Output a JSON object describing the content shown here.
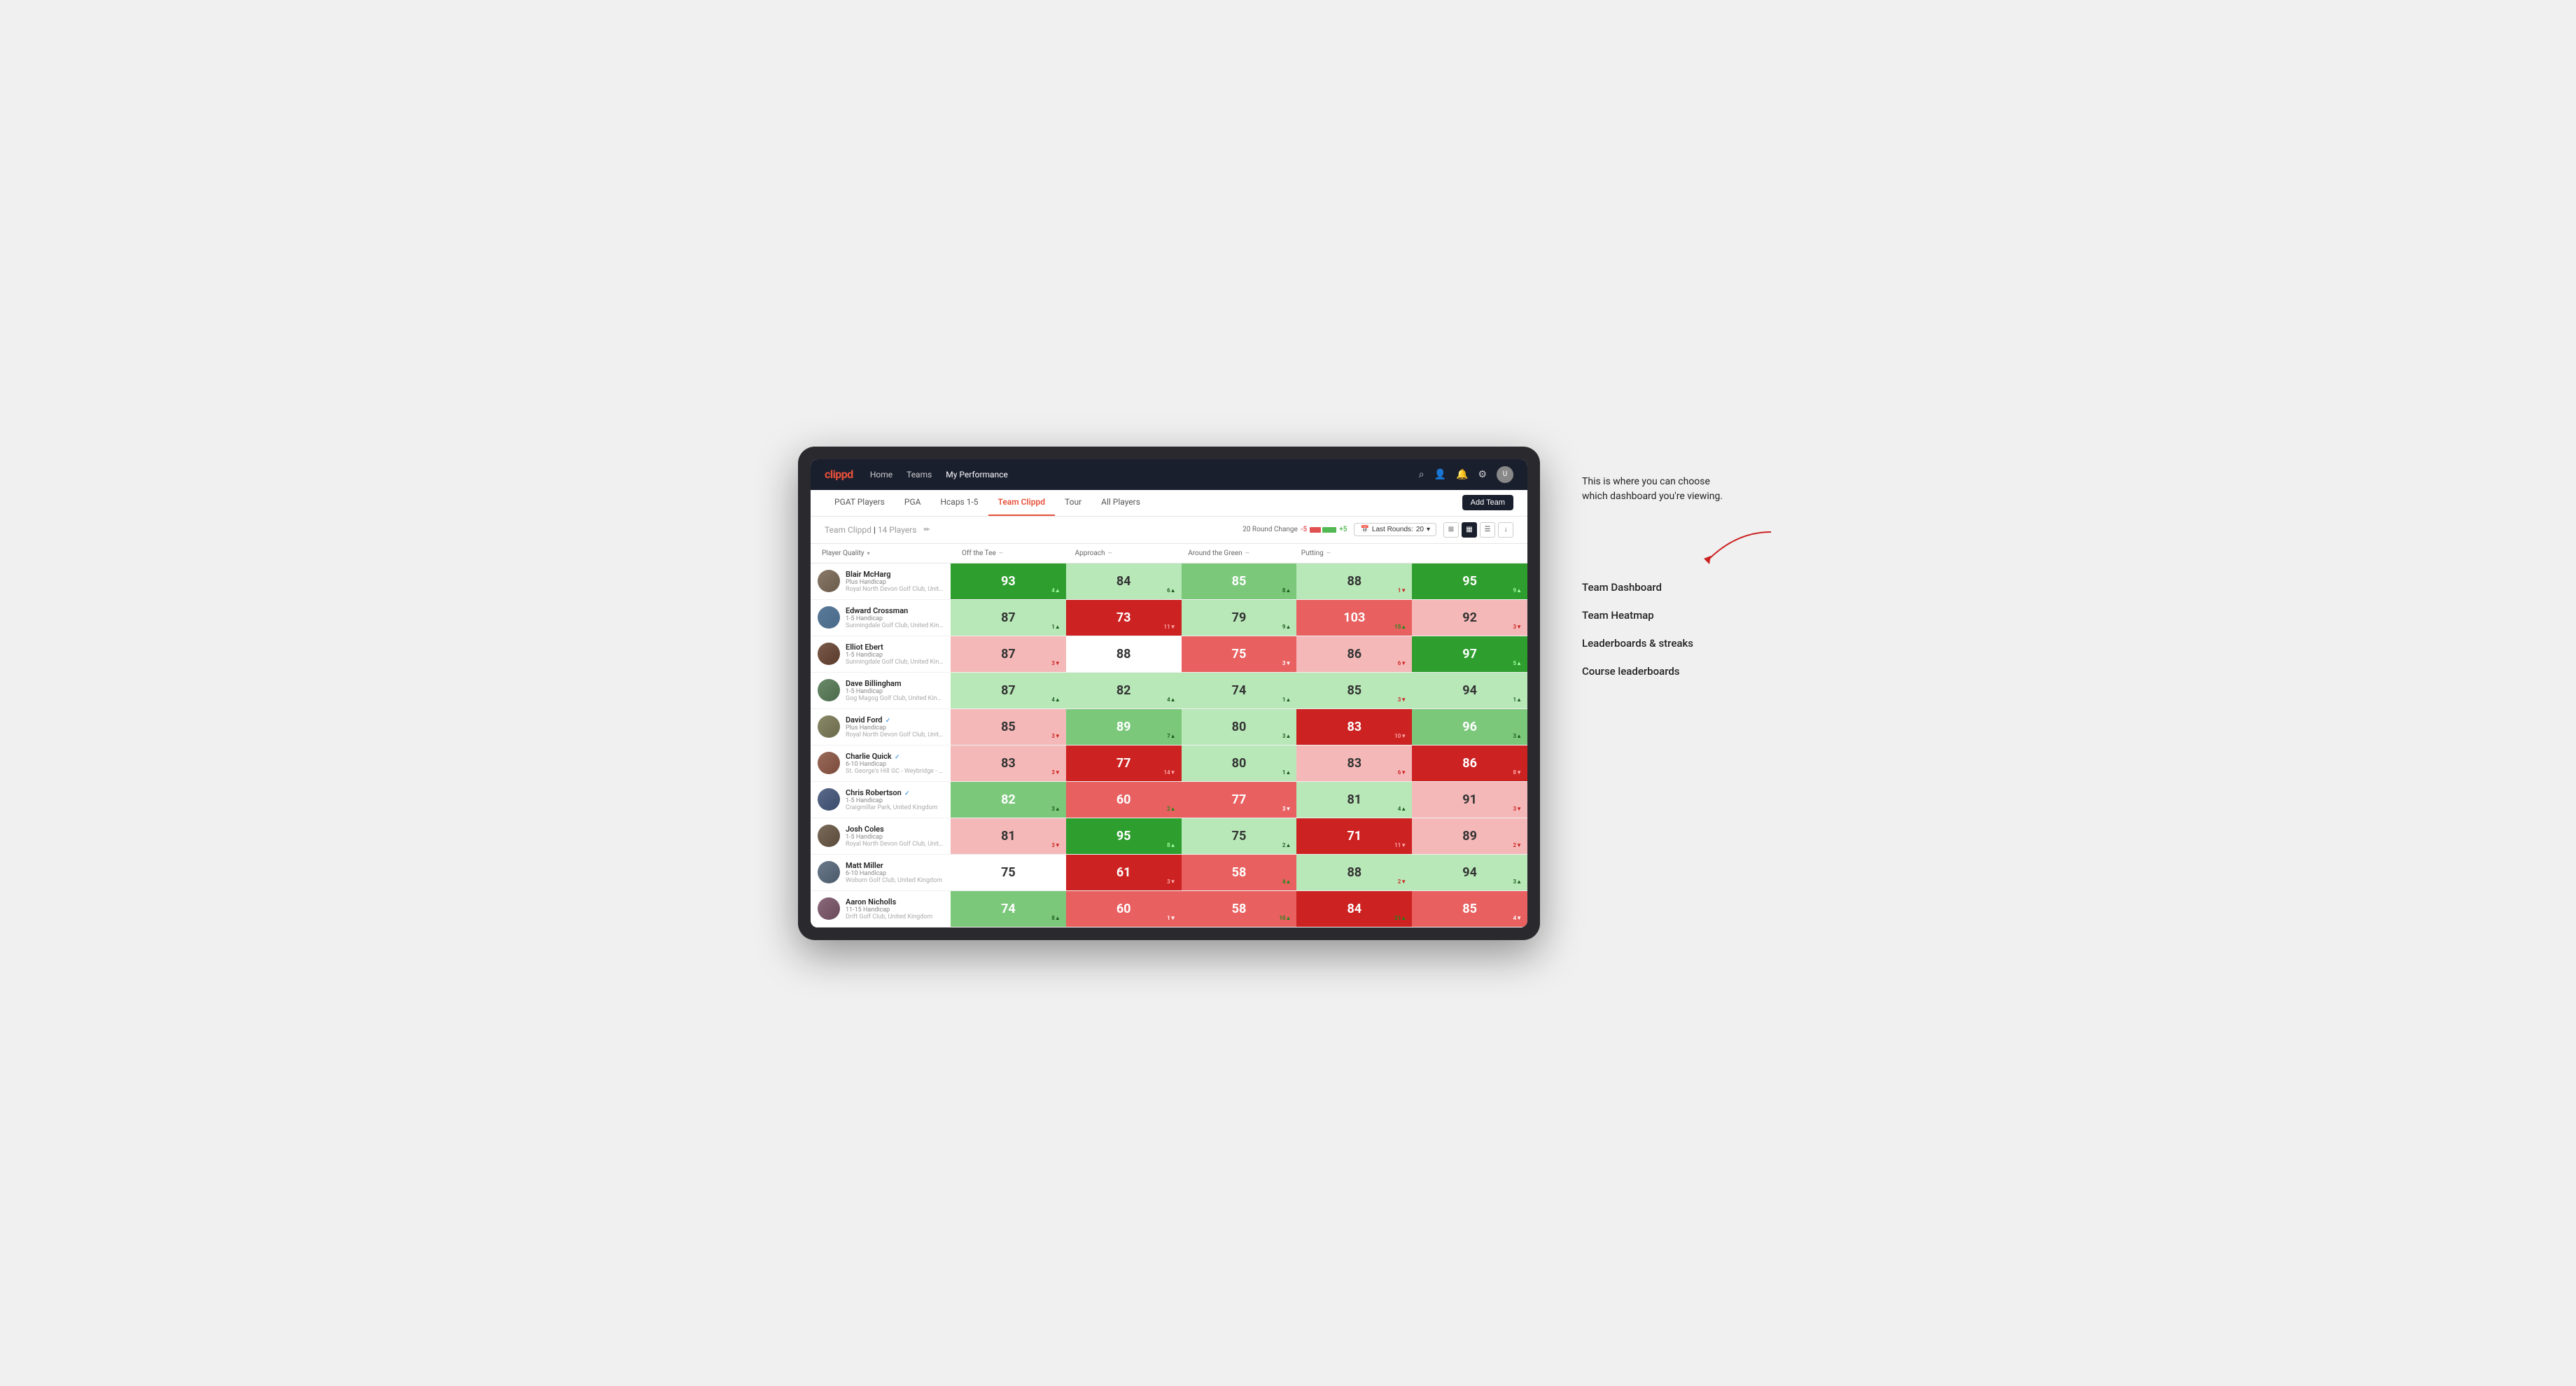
{
  "annotation": {
    "tooltip": "This is where you can choose which dashboard you're viewing.",
    "options": [
      {
        "label": "Team Dashboard"
      },
      {
        "label": "Team Heatmap"
      },
      {
        "label": "Leaderboards & streaks"
      },
      {
        "label": "Course leaderboards"
      }
    ]
  },
  "topNav": {
    "logo": "clippd",
    "links": [
      {
        "label": "Home",
        "active": false
      },
      {
        "label": "Teams",
        "active": false
      },
      {
        "label": "My Performance",
        "active": true
      }
    ]
  },
  "subNav": {
    "links": [
      {
        "label": "PGAT Players",
        "active": false
      },
      {
        "label": "PGA",
        "active": false
      },
      {
        "label": "Hcaps 1-5",
        "active": false
      },
      {
        "label": "Team Clippd",
        "active": true
      },
      {
        "label": "Tour",
        "active": false
      },
      {
        "label": "All Players",
        "active": false
      }
    ],
    "addTeamLabel": "Add Team"
  },
  "teamHeader": {
    "title": "Team Clippd",
    "count": "14 Players",
    "roundChangeLabel": "20 Round Change",
    "minusVal": "-5",
    "plusVal": "+5",
    "lastRoundsLabel": "Last Rounds:",
    "lastRoundsValue": "20"
  },
  "tableColumns": {
    "player": "Player Quality",
    "offTee": "Off the Tee",
    "approach": "Approach",
    "aroundGreen": "Around the Green",
    "putting": "Putting"
  },
  "players": [
    {
      "name": "Blair McHarg",
      "handicap": "Plus Handicap",
      "club": "Royal North Devon Golf Club, United Kingdom",
      "avatarClass": "av-1",
      "scores": [
        {
          "value": "93",
          "change": "4",
          "dir": "up",
          "color": "cell-green-strong"
        },
        {
          "value": "84",
          "change": "6",
          "dir": "up",
          "color": "cell-green-light"
        },
        {
          "value": "85",
          "change": "8",
          "dir": "up",
          "color": "cell-green-medium"
        },
        {
          "value": "88",
          "change": "1",
          "dir": "down",
          "color": "cell-green-light"
        },
        {
          "value": "95",
          "change": "9",
          "dir": "up",
          "color": "cell-green-strong"
        }
      ]
    },
    {
      "name": "Edward Crossman",
      "handicap": "1-5 Handicap",
      "club": "Sunningdale Golf Club, United Kingdom",
      "avatarClass": "av-2",
      "scores": [
        {
          "value": "87",
          "change": "1",
          "dir": "up",
          "color": "cell-green-light"
        },
        {
          "value": "73",
          "change": "11",
          "dir": "down",
          "color": "cell-red-strong"
        },
        {
          "value": "79",
          "change": "9",
          "dir": "up",
          "color": "cell-green-light"
        },
        {
          "value": "103",
          "change": "15",
          "dir": "up",
          "color": "cell-red-medium"
        },
        {
          "value": "92",
          "change": "3",
          "dir": "down",
          "color": "cell-red-light"
        }
      ]
    },
    {
      "name": "Elliot Ebert",
      "handicap": "1-5 Handicap",
      "club": "Sunningdale Golf Club, United Kingdom",
      "avatarClass": "av-3",
      "scores": [
        {
          "value": "87",
          "change": "3",
          "dir": "down",
          "color": "cell-red-light"
        },
        {
          "value": "88",
          "change": "",
          "dir": "",
          "color": "cell-white"
        },
        {
          "value": "75",
          "change": "3",
          "dir": "down",
          "color": "cell-red-medium"
        },
        {
          "value": "86",
          "change": "6",
          "dir": "down",
          "color": "cell-red-light"
        },
        {
          "value": "97",
          "change": "5",
          "dir": "up",
          "color": "cell-green-strong"
        }
      ]
    },
    {
      "name": "Dave Billingham",
      "handicap": "1-5 Handicap",
      "club": "Gog Magog Golf Club, United Kingdom",
      "avatarClass": "av-4",
      "scores": [
        {
          "value": "87",
          "change": "4",
          "dir": "up",
          "color": "cell-green-light"
        },
        {
          "value": "82",
          "change": "4",
          "dir": "up",
          "color": "cell-green-light"
        },
        {
          "value": "74",
          "change": "1",
          "dir": "up",
          "color": "cell-green-light"
        },
        {
          "value": "85",
          "change": "3",
          "dir": "down",
          "color": "cell-green-light"
        },
        {
          "value": "94",
          "change": "1",
          "dir": "up",
          "color": "cell-green-light"
        }
      ]
    },
    {
      "name": "David Ford",
      "handicap": "Plus Handicap",
      "club": "Royal North Devon Golf Club, United Kingdom",
      "avatarClass": "av-5",
      "verified": true,
      "scores": [
        {
          "value": "85",
          "change": "3",
          "dir": "down",
          "color": "cell-red-light"
        },
        {
          "value": "89",
          "change": "7",
          "dir": "up",
          "color": "cell-green-medium"
        },
        {
          "value": "80",
          "change": "3",
          "dir": "up",
          "color": "cell-green-light"
        },
        {
          "value": "83",
          "change": "10",
          "dir": "down",
          "color": "cell-red-strong"
        },
        {
          "value": "96",
          "change": "3",
          "dir": "up",
          "color": "cell-green-medium"
        }
      ]
    },
    {
      "name": "Charlie Quick",
      "handicap": "6-10 Handicap",
      "club": "St. George's Hill GC - Weybridge - Surrey, Uni...",
      "avatarClass": "av-6",
      "verified": true,
      "scores": [
        {
          "value": "83",
          "change": "3",
          "dir": "down",
          "color": "cell-red-light"
        },
        {
          "value": "77",
          "change": "14",
          "dir": "down",
          "color": "cell-red-strong"
        },
        {
          "value": "80",
          "change": "1",
          "dir": "up",
          "color": "cell-green-light"
        },
        {
          "value": "83",
          "change": "6",
          "dir": "down",
          "color": "cell-red-light"
        },
        {
          "value": "86",
          "change": "8",
          "dir": "down",
          "color": "cell-red-strong"
        }
      ]
    },
    {
      "name": "Chris Robertson",
      "handicap": "1-5 Handicap",
      "club": "Craigmillar Park, United Kingdom",
      "avatarClass": "av-7",
      "verified": true,
      "scores": [
        {
          "value": "82",
          "change": "3",
          "dir": "up",
          "color": "cell-green-medium"
        },
        {
          "value": "60",
          "change": "2",
          "dir": "up",
          "color": "cell-red-medium"
        },
        {
          "value": "77",
          "change": "3",
          "dir": "down",
          "color": "cell-red-medium"
        },
        {
          "value": "81",
          "change": "4",
          "dir": "up",
          "color": "cell-green-light"
        },
        {
          "value": "91",
          "change": "3",
          "dir": "down",
          "color": "cell-red-light"
        }
      ]
    },
    {
      "name": "Josh Coles",
      "handicap": "1-5 Handicap",
      "club": "Royal North Devon Golf Club, United Kingdom",
      "avatarClass": "av-8",
      "scores": [
        {
          "value": "81",
          "change": "3",
          "dir": "down",
          "color": "cell-red-light"
        },
        {
          "value": "95",
          "change": "8",
          "dir": "up",
          "color": "cell-green-strong"
        },
        {
          "value": "75",
          "change": "2",
          "dir": "up",
          "color": "cell-green-light"
        },
        {
          "value": "71",
          "change": "11",
          "dir": "down",
          "color": "cell-red-strong"
        },
        {
          "value": "89",
          "change": "2",
          "dir": "down",
          "color": "cell-red-light"
        }
      ]
    },
    {
      "name": "Matt Miller",
      "handicap": "6-10 Handicap",
      "club": "Woburn Golf Club, United Kingdom",
      "avatarClass": "av-9",
      "scores": [
        {
          "value": "75",
          "change": "",
          "dir": "",
          "color": "cell-white"
        },
        {
          "value": "61",
          "change": "3",
          "dir": "down",
          "color": "cell-red-strong"
        },
        {
          "value": "58",
          "change": "4",
          "dir": "up",
          "color": "cell-red-medium"
        },
        {
          "value": "88",
          "change": "2",
          "dir": "down",
          "color": "cell-green-light"
        },
        {
          "value": "94",
          "change": "3",
          "dir": "up",
          "color": "cell-green-light"
        }
      ]
    },
    {
      "name": "Aaron Nicholls",
      "handicap": "11-15 Handicap",
      "club": "Drift Golf Club, United Kingdom",
      "avatarClass": "av-10",
      "scores": [
        {
          "value": "74",
          "change": "8",
          "dir": "up",
          "color": "cell-green-medium"
        },
        {
          "value": "60",
          "change": "1",
          "dir": "down",
          "color": "cell-red-medium"
        },
        {
          "value": "58",
          "change": "10",
          "dir": "up",
          "color": "cell-red-medium"
        },
        {
          "value": "84",
          "change": "21",
          "dir": "up",
          "color": "cell-red-strong"
        },
        {
          "value": "85",
          "change": "4",
          "dir": "down",
          "color": "cell-red-medium"
        }
      ]
    }
  ]
}
